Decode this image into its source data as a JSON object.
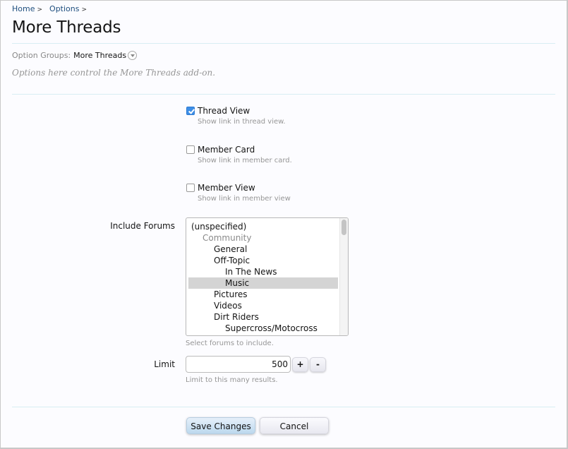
{
  "breadcrumb": [
    {
      "label": "Home",
      "sep": ">"
    },
    {
      "label": "Options",
      "sep": ">"
    }
  ],
  "page_title": "More Threads",
  "option_groups": {
    "label": "Option Groups:",
    "value": "More Threads",
    "icon": "chevron-down-circle-icon"
  },
  "description": "Options here control the More Threads add-on.",
  "options": [
    {
      "label": "Thread View",
      "hint": "Show link in thread view.",
      "checked": true
    },
    {
      "label": "Member Card",
      "hint": "Show link in member card.",
      "checked": false
    },
    {
      "label": "Member View",
      "hint": "Show link in member view",
      "checked": false
    }
  ],
  "include_forums": {
    "label": "Include Forums",
    "hint": "Select forums to include.",
    "items": [
      {
        "label": "(unspecified)",
        "depth": 0,
        "disabled": false,
        "selected": false
      },
      {
        "label": "Community",
        "depth": 1,
        "disabled": true,
        "selected": false
      },
      {
        "label": "General",
        "depth": 2,
        "disabled": false,
        "selected": false
      },
      {
        "label": "Off-Topic",
        "depth": 2,
        "disabled": false,
        "selected": false
      },
      {
        "label": "In The News",
        "depth": 3,
        "disabled": false,
        "selected": false
      },
      {
        "label": "Music",
        "depth": 3,
        "disabled": false,
        "selected": true
      },
      {
        "label": "Pictures",
        "depth": 2,
        "disabled": false,
        "selected": false
      },
      {
        "label": "Videos",
        "depth": 2,
        "disabled": false,
        "selected": false
      },
      {
        "label": "Dirt Riders",
        "depth": 2,
        "disabled": false,
        "selected": false
      },
      {
        "label": "Supercross/Motocross",
        "depth": 3,
        "disabled": false,
        "selected": false
      }
    ]
  },
  "limit": {
    "label": "Limit",
    "value": "500",
    "hint": "Limit to this many results.",
    "increment_label": "+",
    "decrement_label": "-"
  },
  "actions": {
    "save_label": "Save Changes",
    "cancel_label": "Cancel"
  },
  "colors": {
    "link": "#1f4f7f",
    "divider": "#d8eef3",
    "checkbox_checked": "#3d8ee6",
    "primary_button": "#bcd8ee",
    "selected_option": "#d4d4d4"
  }
}
